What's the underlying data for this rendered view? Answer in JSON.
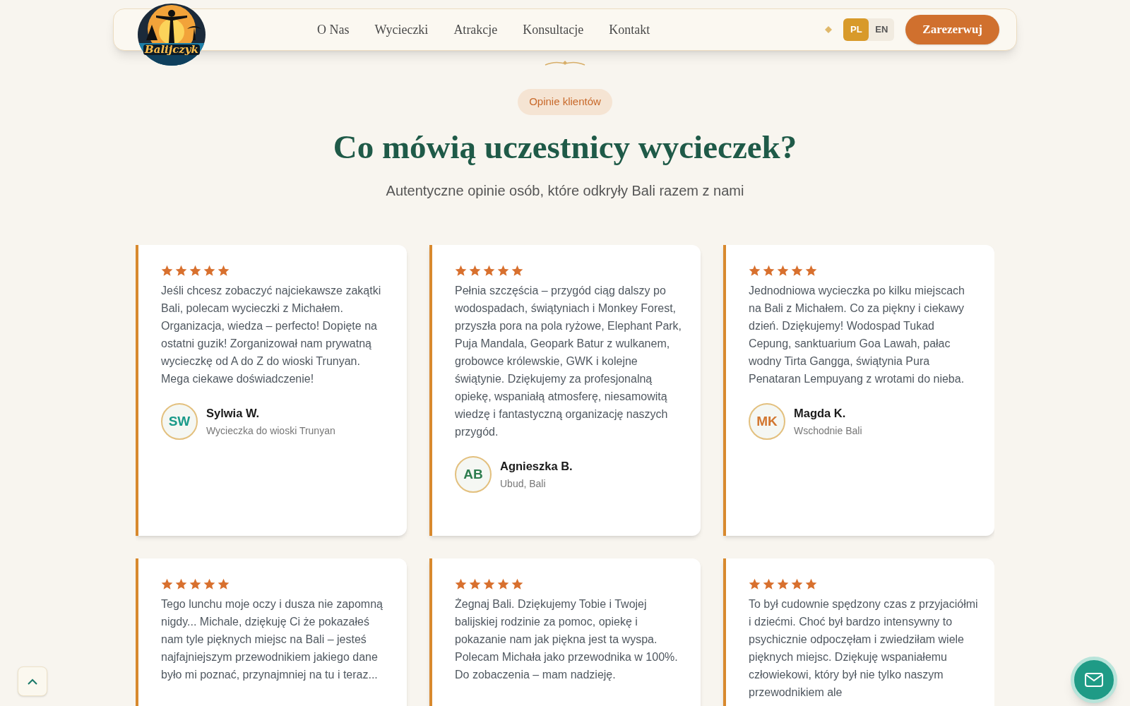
{
  "header": {
    "logo_text": "Balijczyk",
    "nav": [
      {
        "label": "O Nas"
      },
      {
        "label": "Wycieczki"
      },
      {
        "label": "Atrakcje"
      },
      {
        "label": "Konsultacje"
      },
      {
        "label": "Kontakt"
      }
    ],
    "languages": [
      {
        "label": "PL",
        "selected": true
      },
      {
        "label": "EN",
        "selected": false
      }
    ],
    "cta": "Zarezerwuj"
  },
  "section": {
    "badge": "Opinie klientów",
    "title": "Co mówią uczestnicy wycieczek?",
    "subtitle": "Autentyczne opinie osób, które odkryły Bali razem z nami"
  },
  "reviews": [
    {
      "stars": 5,
      "text": "Jeśli chcesz zobaczyć najciekawsze zakątki Bali, polecam wycieczki z Michałem. Organizacja, wiedza – perfecto! Dopięte na ostatni guzik! Zorganizował nam prywatną wycieczkę od A do Z do wioski Trunyan. Mega ciekawe doświadczenie!",
      "initials": "SW",
      "color": "#1a9a8a",
      "name": "Sylwia W.",
      "detail": "Wycieczka do wioski Trunyan"
    },
    {
      "stars": 5,
      "text": "Pełnia szczęścia – przygód ciąg dalszy po wodospadach, świątyniach i Monkey Forest, przyszła pora na pola ryżowe, Elephant Park, Puja Mandala, Geopark Batur z wulkanem, grobowce królewskie, GWK i kolejne świątynie. Dziękujemy za profesjonalną opiekę, wspaniałą atmosferę, niesamowitą wiedzę i fantastyczną organizację naszych przygód.",
      "initials": "AB",
      "color": "#2e7d4f",
      "name": "Agnieszka B.",
      "detail": "Ubud, Bali"
    },
    {
      "stars": 5,
      "text": "Jednodniowa wycieczka po kilku miejscach na Bali z Michałem. Co za piękny i ciekawy dzień. Dziękujemy! Wodospad Tukad Cepung, sanktuarium Goa Lawah, pałac wodny Tirta Gangga, świątynia Pura Penataran Lempuyang z wrotami do nieba.",
      "initials": "MK",
      "color": "#d2762f",
      "name": "Magda K.",
      "detail": "Wschodnie Bali"
    },
    {
      "stars": 5,
      "text": "Tego lunchu moje oczy i dusza nie zapomną nigdy... Michale, dziękuję Ci że pokazałeś nam tyle pięknych miejsc na Bali – jesteś najfajniejszym przewodnikiem jakiego dane było mi poznać, przynajmniej na tu i teraz..."
    },
    {
      "stars": 5,
      "text": "Żegnaj Bali. Dziękujemy Tobie i Twojej balijskiej rodzinie za pomoc, opiekę i pokazanie nam jak piękna jest ta wyspa. Polecam Michała jako przewodnika w 100%. Do zobaczenia – mam nadzieję."
    },
    {
      "stars": 5,
      "text": "To był cudownie spędzony czas z przyjaciółmi i dziećmi. Choć był bardzo intensywny to psychicznie odpoczęłam i zwiedziłam wiele pięknych miejsc. Dziękuję wspaniałemu człowiekowi, który był nie tylko naszym przewodnikiem ale"
    }
  ]
}
